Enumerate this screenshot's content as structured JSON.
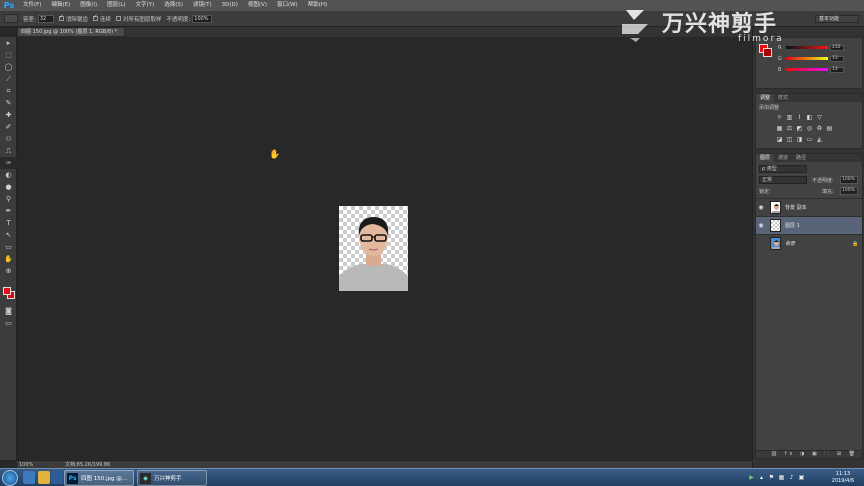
{
  "app": {
    "logo": "Ps"
  },
  "menu": [
    "文件(F)",
    "编辑(E)",
    "图像(I)",
    "图层(L)",
    "文字(Y)",
    "选择(S)",
    "滤镜(T)",
    "3D(D)",
    "视图(V)",
    "窗口(W)",
    "帮助(H)"
  ],
  "workspace_label": "基本功能",
  "options": {
    "tolerance_label": "容差:",
    "tolerance_value": "32",
    "antialias_label": "消除锯齿",
    "contiguous_label": "连续",
    "all_layers_label": "对所有图层取样",
    "opacity_label": "不透明度:",
    "opacity_value": "100%"
  },
  "document": {
    "tab": "四图 150.jpg @ 100% (图层 1, RGB/8) *",
    "zoom": "100%",
    "doc_size": "文档:85.2K/199.8K"
  },
  "tools": [
    "▸",
    "⬚",
    "◯",
    "⟋",
    "⌗",
    "✎",
    "✚",
    "✐",
    "⚇",
    "⎍",
    "✑",
    "◐",
    "●",
    "⚲",
    "✒",
    "T",
    "↖",
    "▭",
    "✋",
    "⊕"
  ],
  "color_panel": {
    "rows": [
      {
        "label": "R",
        "value": "232",
        "gradient": "linear-gradient(90deg,#001313,#ff1313)"
      },
      {
        "label": "G",
        "value": "13",
        "gradient": "linear-gradient(90deg,#e80013,#e8ff13)"
      },
      {
        "label": "B",
        "value": "13",
        "gradient": "linear-gradient(90deg,#e80d00,#e80dff)"
      }
    ],
    "foreground": "#e80d0d"
  },
  "adjustments_panel": {
    "tabs": [
      "调整",
      "样式"
    ],
    "title": "添加调整"
  },
  "layers_panel": {
    "tabs": [
      "图层",
      "通道",
      "路径"
    ],
    "kind_label": "ρ 类型",
    "blend_mode": "正常",
    "opacity_label": "不透明度:",
    "opacity_value": "100%",
    "lock_label": "锁定:",
    "fill_label": "填充:",
    "fill_value": "100%",
    "layers": [
      {
        "name": "背景 副本",
        "visible": true,
        "selected": false,
        "thumb": "photo"
      },
      {
        "name": "图层 1",
        "visible": true,
        "selected": true,
        "thumb": "checker"
      },
      {
        "name": "背景",
        "visible": false,
        "selected": false,
        "thumb": "photo-blue",
        "locked": true
      }
    ]
  },
  "watermark": {
    "brand": "万兴神剪手",
    "sub": "filmora"
  },
  "taskbar": {
    "ps_button": "四图 150.jpg @...",
    "app_button": "万兴神剪手",
    "time": "11:13",
    "date": "2019/4/6"
  }
}
